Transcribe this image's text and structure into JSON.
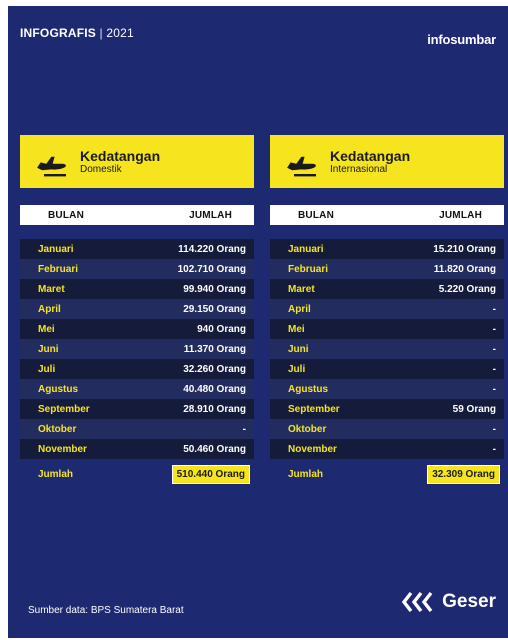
{
  "header": {
    "label": "INFOGRAFIS",
    "separator": "|",
    "year": "2021",
    "brand": "infosumbar"
  },
  "colors": {
    "background": "#1d2a72",
    "accent": "#f6e51e",
    "row_dark": "#151b3b",
    "row_light": "#232c5e"
  },
  "columns": {
    "month": "BULAN",
    "total": "JUMLAH"
  },
  "panels": [
    {
      "title": "Kedatangan",
      "subtitle": "Domestik",
      "icon": "airplane-landing-icon",
      "rows": [
        {
          "month": "Januari",
          "value": "114.220 Orang"
        },
        {
          "month": "Februari",
          "value": "102.710 Orang"
        },
        {
          "month": "Maret",
          "value": "99.940 Orang"
        },
        {
          "month": "April",
          "value": "29.150 Orang"
        },
        {
          "month": "Mei",
          "value": "940 Orang"
        },
        {
          "month": "Juni",
          "value": "11.370 Orang"
        },
        {
          "month": "Juli",
          "value": "32.260 Orang"
        },
        {
          "month": "Agustus",
          "value": "40.480 Orang"
        },
        {
          "month": "September",
          "value": "28.910 Orang"
        },
        {
          "month": "Oktober",
          "value": "-"
        },
        {
          "month": "November",
          "value": "50.460 Orang"
        }
      ],
      "total_label": "Jumlah",
      "total_value": "510.440 Orang"
    },
    {
      "title": "Kedatangan",
      "subtitle": "Internasional",
      "icon": "airplane-landing-icon",
      "rows": [
        {
          "month": "Januari",
          "value": "15.210 Orang"
        },
        {
          "month": "Februari",
          "value": "11.820 Orang"
        },
        {
          "month": "Maret",
          "value": "5.220 Orang"
        },
        {
          "month": "April",
          "value": "-"
        },
        {
          "month": "Mei",
          "value": "-"
        },
        {
          "month": "Juni",
          "value": "-"
        },
        {
          "month": "Juli",
          "value": "-"
        },
        {
          "month": "Agustus",
          "value": "-"
        },
        {
          "month": "September",
          "value": "59 Orang"
        },
        {
          "month": "Oktober",
          "value": "-"
        },
        {
          "month": "November",
          "value": "-"
        }
      ],
      "total_label": "Jumlah",
      "total_value": "32.309 Orang"
    }
  ],
  "footer": {
    "source": "Sumber data: BPS Sumatera Barat",
    "next_label": "Geser",
    "next_icon": "triple-chevron-left-icon"
  }
}
